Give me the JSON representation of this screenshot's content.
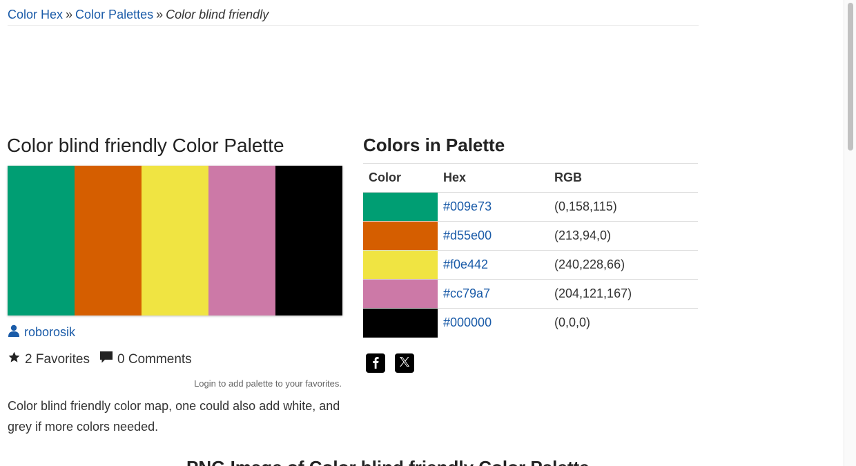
{
  "breadcrumb": {
    "items": [
      {
        "label": "Color Hex"
      },
      {
        "label": "Color Palettes"
      }
    ],
    "separator": "»",
    "current": "Color blind friendly"
  },
  "palette": {
    "title": "Color blind friendly Color Palette",
    "colors": [
      "#009e73",
      "#d55e00",
      "#f0e442",
      "#cc79a7",
      "#000000"
    ],
    "author": "roborosik",
    "favorites": "2 Favorites",
    "comments": "0 Comments",
    "login_note": "Login to add palette to your favorites.",
    "description": "Color blind friendly color map, one could also add white, and grey if more colors needed.",
    "png_heading": "PNG Image of Color blind friendly Color Palette"
  },
  "colors_table": {
    "title": "Colors in Palette",
    "headers": [
      "Color",
      "Hex",
      "RGB"
    ],
    "rows": [
      {
        "hex": "#009e73",
        "rgb": "(0,158,115)"
      },
      {
        "hex": "#d55e00",
        "rgb": "(213,94,0)"
      },
      {
        "hex": "#f0e442",
        "rgb": "(240,228,66)"
      },
      {
        "hex": "#cc79a7",
        "rgb": "(204,121,167)"
      },
      {
        "hex": "#000000",
        "rgb": "(0,0,0)"
      }
    ]
  },
  "share": {
    "icons": [
      "facebook-icon",
      "x-icon"
    ]
  },
  "theme": {
    "link_color": "#1a5ba8"
  }
}
